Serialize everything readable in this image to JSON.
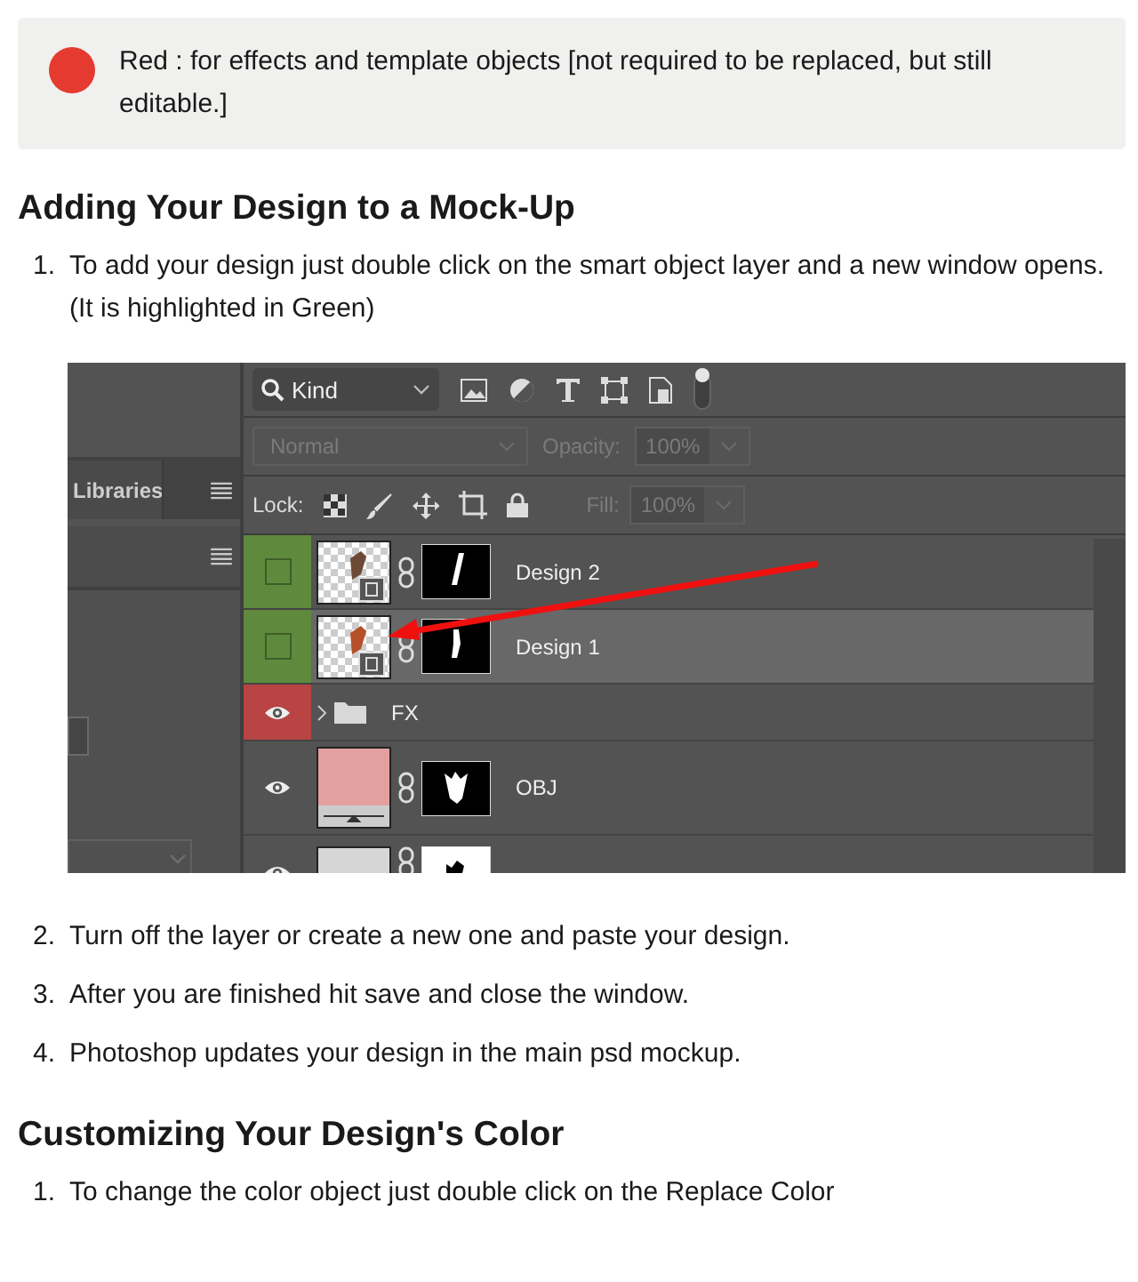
{
  "blocks": [
    {
      "kind": "note",
      "color": "#e53a2f",
      "text": "Red : for effects and template objects [not required to be replaced, but still editable.]"
    },
    {
      "kind": "heading",
      "text": "Adding Your Design to a Mock-Up"
    },
    {
      "kind": "step",
      "number": "1.",
      "text": "To add your design just double click on the smart object layer and a new window opens. (It is highlighted in Green)"
    },
    {
      "kind": "screenshot",
      "side_panel": {
        "tab": "Libraries"
      },
      "layers_panel": {
        "filter": "Kind",
        "blend_mode": {
          "value": "Normal",
          "disabled": true
        },
        "opacity": {
          "label": "Opacity:",
          "value": "100%",
          "disabled": true
        },
        "lock_label": "Lock:",
        "fill": {
          "label": "Fill:",
          "value": "100%",
          "disabled": true
        },
        "layers": [
          {
            "name": "Design 2",
            "kind": "smart",
            "visible": false,
            "selected": false,
            "color": "#5f8a3d"
          },
          {
            "name": "Design 1",
            "kind": "smart",
            "visible": false,
            "selected": true,
            "color": "#5f8a3d"
          },
          {
            "name": "FX",
            "kind": "group",
            "visible": true,
            "selected": false,
            "color": "#b84444"
          },
          {
            "name": "OBJ",
            "kind": "fill",
            "visible": true,
            "selected": false
          },
          {
            "kind": "solid",
            "visible": true,
            "selected": false
          }
        ]
      }
    },
    {
      "kind": "step",
      "number": "2.",
      "text": "Turn off the layer or create a new one and paste your design."
    },
    {
      "kind": "step",
      "number": "3.",
      "text": "After you are finished hit save and close the window."
    },
    {
      "kind": "step",
      "number": "4.",
      "text": "Photoshop updates your design in the main psd mockup."
    },
    {
      "kind": "heading",
      "text": "Customizing Your Design's Color"
    },
    {
      "kind": "step",
      "number": "1.",
      "text": "To change the color object just double click on the Replace Color"
    }
  ]
}
